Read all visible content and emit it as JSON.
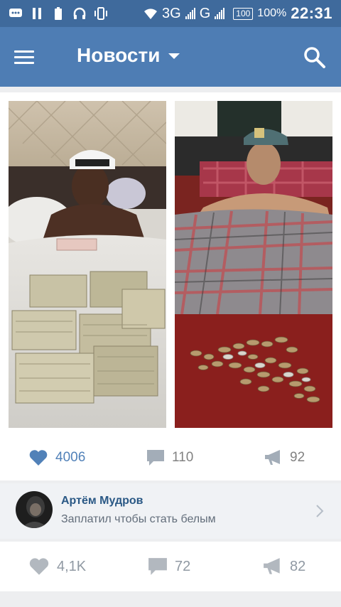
{
  "status_bar": {
    "network_3g": "3G",
    "network_g": "G",
    "battery_box": "100",
    "battery_percent": "100%",
    "time": "22:31"
  },
  "appbar": {
    "title": "Новости",
    "menu_icon": "hamburger-menu-icon",
    "search_icon": "search-icon",
    "dropdown_icon": "caret-down-icon"
  },
  "post": {
    "images": [
      {
        "name": "photo-money-stacks"
      },
      {
        "name": "photo-coins"
      }
    ],
    "likes": "4006",
    "comments": "110",
    "reposts": "92"
  },
  "comment_preview": {
    "author": "Артём Мудров",
    "text": "Заплатил чтобы стать белым"
  },
  "next_post": {
    "likes": "4,1K",
    "comments": "72",
    "reposts": "82"
  },
  "colors": {
    "status_bar": "#3f6a9c",
    "appbar": "#4e7db4",
    "like_accent": "#5181b8",
    "author_name": "#2a5885",
    "muted": "#828282"
  }
}
